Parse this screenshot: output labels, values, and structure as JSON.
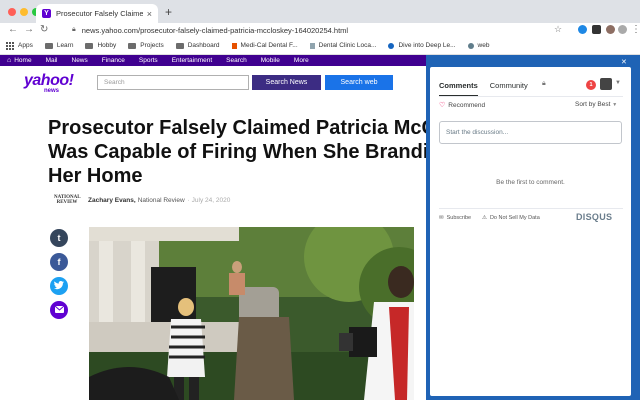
{
  "browser": {
    "tab_title": "Prosecutor Falsely Claimed Pat",
    "url": "news.yahoo.com/prosecutor-falsely-claimed-patricia-mccloskey-164020254.html",
    "bookmarks": [
      {
        "label": "Apps",
        "icon": "apps-grid-icon"
      },
      {
        "label": "Learn",
        "icon": "folder-icon"
      },
      {
        "label": "Hobby",
        "icon": "folder-icon"
      },
      {
        "label": "Projects",
        "icon": "folder-icon"
      },
      {
        "label": "Dashboard",
        "icon": "folder-icon"
      },
      {
        "label": "Medi-Cal Dental F...",
        "icon": "medi-cal-favicon"
      },
      {
        "label": "Dental Clinic Loca...",
        "icon": "dental-clinic-favicon"
      },
      {
        "label": "Dive into Deep Le...",
        "icon": "deep-learning-favicon"
      },
      {
        "label": "web",
        "icon": "web-globe-icon"
      }
    ]
  },
  "yahoo": {
    "nav": [
      "Home",
      "Mail",
      "News",
      "Finance",
      "Sports",
      "Entertainment",
      "Search",
      "Mobile",
      "More"
    ],
    "logo": "yahoo!",
    "logo_sub": "news",
    "search_placeholder": "Search",
    "search_news_label": "Search News",
    "search_web_label": "Search web"
  },
  "article": {
    "headline_lines": [
      "Prosecutor Falsely Claimed Patricia McC",
      "Was Capable of Firing When She Brandi",
      "Her Home"
    ],
    "publisher_logo": "NATIONAL REVIEW",
    "author": "Zachary Evans,",
    "publisher": "National Review",
    "date": "July 24, 2020",
    "share_icons": [
      "tumblr-icon",
      "facebook-icon",
      "twitter-icon",
      "mail-icon"
    ]
  },
  "disqus": {
    "tab_comments": "Comments",
    "tab_community": "Community",
    "notification_count": "1",
    "recommend_label": "Recommend",
    "sort_label": "Sort by Best",
    "input_placeholder": "Start the discussion...",
    "empty_text": "Be the first to comment.",
    "subscribe_label": "Subscribe",
    "dnsmd_label": "Do Not Sell My Data",
    "logo_text": "DISQUS"
  },
  "colors": {
    "yahoo_purple": "#6001d2",
    "yahoo_nav": "#400090",
    "disqus_blue": "#1f63b5"
  }
}
